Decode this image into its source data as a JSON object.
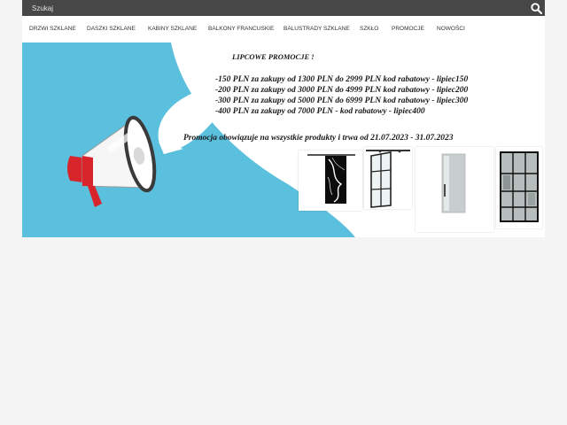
{
  "search": {
    "placeholder": "Szukaj"
  },
  "nav": {
    "items": [
      {
        "label": "DRZWI SZKLANE"
      },
      {
        "label": "DASZKI SZKLANE"
      },
      {
        "label": "KABINY SZKLANE"
      },
      {
        "label": "BALKONY FRANCUSKIE"
      },
      {
        "label": "BALUSTRADY SZKLANE"
      },
      {
        "label": "SZKŁO"
      },
      {
        "label": "PROMOCJE"
      },
      {
        "label": "NOWOŚCI"
      }
    ]
  },
  "banner": {
    "title": "LIPCOWE PROMOCJE !",
    "lines": [
      "-150 PLN  za zakupy od 1300 PLN do 2999 PLN  kod rabatowy - lipiec150",
      "-200 PLN za zakupy od 3000 PLN do 4999 PLN kod rabatowy - lipiec200",
      "-300 PLN za zakupy od 5000 PLN do 6999 PLN  kod rabatowy - lipiec300",
      "-400 PLN za zakupy od 7000 PLN -  kod rabatowy - lipiec400"
    ],
    "note": "Promocja obowiązuje na wszystkie produkty i trwa od 21.07.2023 - 31.07.2023"
  },
  "colors": {
    "topbar": "#474747",
    "banner_blue": "#5bc0de",
    "megaphone_red": "#d8242b",
    "page_bg": "#f4f4f4"
  },
  "icons": {
    "search": "search-icon",
    "megaphone": "megaphone-icon"
  }
}
